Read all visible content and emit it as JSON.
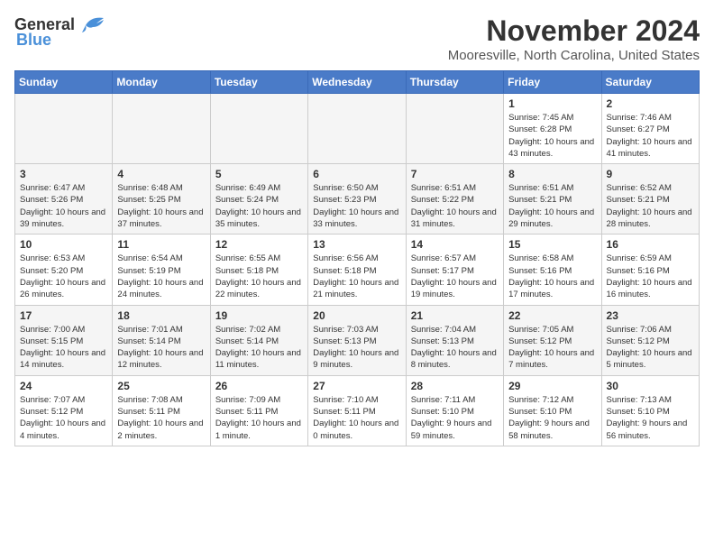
{
  "logo": {
    "text_general": "General",
    "text_blue": "Blue"
  },
  "title": "November 2024",
  "location": "Mooresville, North Carolina, United States",
  "weekdays": [
    "Sunday",
    "Monday",
    "Tuesday",
    "Wednesday",
    "Thursday",
    "Friday",
    "Saturday"
  ],
  "weeks": [
    [
      {
        "day": "",
        "info": ""
      },
      {
        "day": "",
        "info": ""
      },
      {
        "day": "",
        "info": ""
      },
      {
        "day": "",
        "info": ""
      },
      {
        "day": "",
        "info": ""
      },
      {
        "day": "1",
        "info": "Sunrise: 7:45 AM\nSunset: 6:28 PM\nDaylight: 10 hours and 43 minutes."
      },
      {
        "day": "2",
        "info": "Sunrise: 7:46 AM\nSunset: 6:27 PM\nDaylight: 10 hours and 41 minutes."
      }
    ],
    [
      {
        "day": "3",
        "info": "Sunrise: 6:47 AM\nSunset: 5:26 PM\nDaylight: 10 hours and 39 minutes."
      },
      {
        "day": "4",
        "info": "Sunrise: 6:48 AM\nSunset: 5:25 PM\nDaylight: 10 hours and 37 minutes."
      },
      {
        "day": "5",
        "info": "Sunrise: 6:49 AM\nSunset: 5:24 PM\nDaylight: 10 hours and 35 minutes."
      },
      {
        "day": "6",
        "info": "Sunrise: 6:50 AM\nSunset: 5:23 PM\nDaylight: 10 hours and 33 minutes."
      },
      {
        "day": "7",
        "info": "Sunrise: 6:51 AM\nSunset: 5:22 PM\nDaylight: 10 hours and 31 minutes."
      },
      {
        "day": "8",
        "info": "Sunrise: 6:51 AM\nSunset: 5:21 PM\nDaylight: 10 hours and 29 minutes."
      },
      {
        "day": "9",
        "info": "Sunrise: 6:52 AM\nSunset: 5:21 PM\nDaylight: 10 hours and 28 minutes."
      }
    ],
    [
      {
        "day": "10",
        "info": "Sunrise: 6:53 AM\nSunset: 5:20 PM\nDaylight: 10 hours and 26 minutes."
      },
      {
        "day": "11",
        "info": "Sunrise: 6:54 AM\nSunset: 5:19 PM\nDaylight: 10 hours and 24 minutes."
      },
      {
        "day": "12",
        "info": "Sunrise: 6:55 AM\nSunset: 5:18 PM\nDaylight: 10 hours and 22 minutes."
      },
      {
        "day": "13",
        "info": "Sunrise: 6:56 AM\nSunset: 5:18 PM\nDaylight: 10 hours and 21 minutes."
      },
      {
        "day": "14",
        "info": "Sunrise: 6:57 AM\nSunset: 5:17 PM\nDaylight: 10 hours and 19 minutes."
      },
      {
        "day": "15",
        "info": "Sunrise: 6:58 AM\nSunset: 5:16 PM\nDaylight: 10 hours and 17 minutes."
      },
      {
        "day": "16",
        "info": "Sunrise: 6:59 AM\nSunset: 5:16 PM\nDaylight: 10 hours and 16 minutes."
      }
    ],
    [
      {
        "day": "17",
        "info": "Sunrise: 7:00 AM\nSunset: 5:15 PM\nDaylight: 10 hours and 14 minutes."
      },
      {
        "day": "18",
        "info": "Sunrise: 7:01 AM\nSunset: 5:14 PM\nDaylight: 10 hours and 12 minutes."
      },
      {
        "day": "19",
        "info": "Sunrise: 7:02 AM\nSunset: 5:14 PM\nDaylight: 10 hours and 11 minutes."
      },
      {
        "day": "20",
        "info": "Sunrise: 7:03 AM\nSunset: 5:13 PM\nDaylight: 10 hours and 9 minutes."
      },
      {
        "day": "21",
        "info": "Sunrise: 7:04 AM\nSunset: 5:13 PM\nDaylight: 10 hours and 8 minutes."
      },
      {
        "day": "22",
        "info": "Sunrise: 7:05 AM\nSunset: 5:12 PM\nDaylight: 10 hours and 7 minutes."
      },
      {
        "day": "23",
        "info": "Sunrise: 7:06 AM\nSunset: 5:12 PM\nDaylight: 10 hours and 5 minutes."
      }
    ],
    [
      {
        "day": "24",
        "info": "Sunrise: 7:07 AM\nSunset: 5:12 PM\nDaylight: 10 hours and 4 minutes."
      },
      {
        "day": "25",
        "info": "Sunrise: 7:08 AM\nSunset: 5:11 PM\nDaylight: 10 hours and 2 minutes."
      },
      {
        "day": "26",
        "info": "Sunrise: 7:09 AM\nSunset: 5:11 PM\nDaylight: 10 hours and 1 minute."
      },
      {
        "day": "27",
        "info": "Sunrise: 7:10 AM\nSunset: 5:11 PM\nDaylight: 10 hours and 0 minutes."
      },
      {
        "day": "28",
        "info": "Sunrise: 7:11 AM\nSunset: 5:10 PM\nDaylight: 9 hours and 59 minutes."
      },
      {
        "day": "29",
        "info": "Sunrise: 7:12 AM\nSunset: 5:10 PM\nDaylight: 9 hours and 58 minutes."
      },
      {
        "day": "30",
        "info": "Sunrise: 7:13 AM\nSunset: 5:10 PM\nDaylight: 9 hours and 56 minutes."
      }
    ]
  ]
}
